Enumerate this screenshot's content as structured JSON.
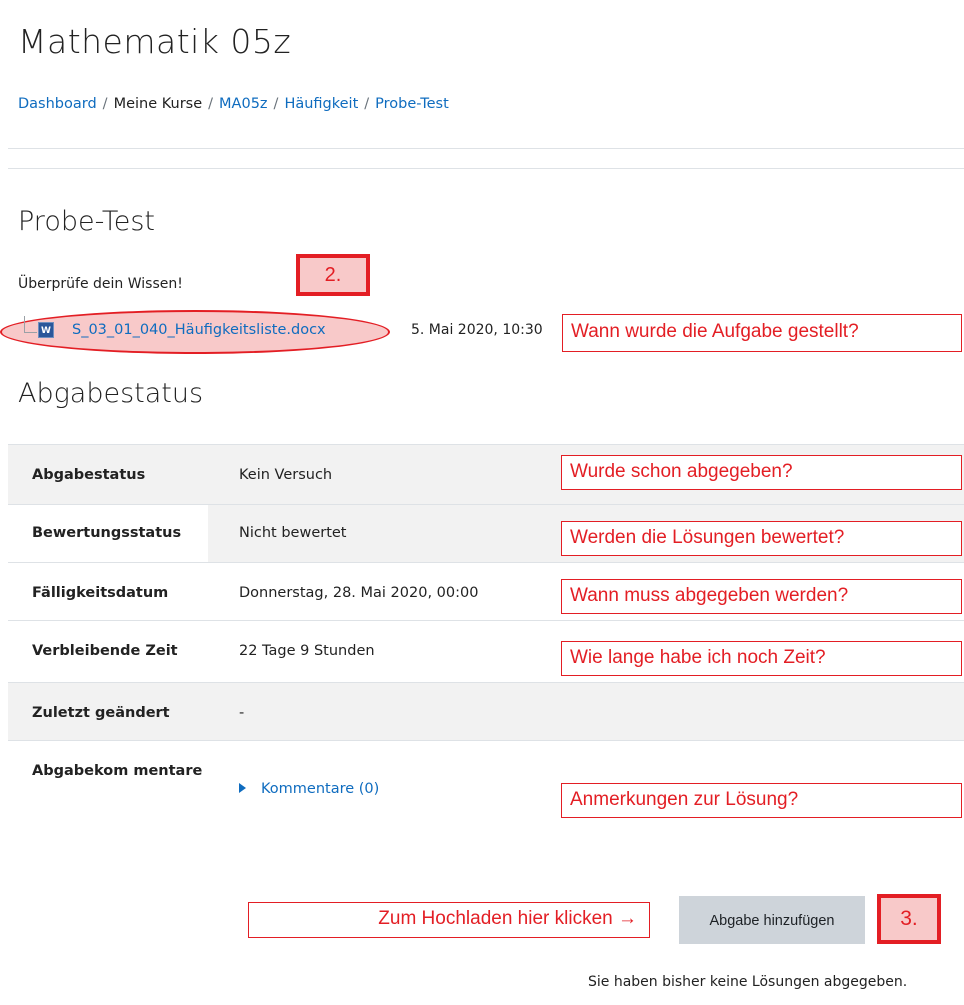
{
  "course": {
    "title": "Mathematik 05z"
  },
  "breadcrumb": {
    "items": [
      {
        "label": "Dashboard",
        "link": true
      },
      {
        "label": "Meine Kurse",
        "link": false
      },
      {
        "label": "MA05z",
        "link": true
      },
      {
        "label": "Häufigkeit",
        "link": true
      },
      {
        "label": "Probe-Test",
        "link": true
      }
    ],
    "separator": "/"
  },
  "assignment": {
    "title": "Probe-Test",
    "intro": "Überprüfe dein Wissen!",
    "file": {
      "name": "S_03_01_040_Häufigkeitsliste.docx",
      "icon": "word-file-icon",
      "date": "5. Mai 2020, 10:30"
    }
  },
  "status_section": {
    "title": "Abgabestatus",
    "rows": [
      {
        "label": "Abgabestatus",
        "value": "Kein Versuch"
      },
      {
        "label": "Bewertungsstatus",
        "value": "Nicht bewertet"
      },
      {
        "label": "Fälligkeitsdatum",
        "value": "Donnerstag, 28. Mai 2020, 00:00"
      },
      {
        "label": "Verbleibende Zeit",
        "value": "22 Tage 9 Stunden"
      },
      {
        "label": "Zuletzt geändert",
        "value": "-"
      },
      {
        "label": "Abgabekom mentare",
        "value": "Kommentare (0)"
      }
    ]
  },
  "actions": {
    "submit_label": "Abgabe hinzufügen",
    "note": "Sie haben bisher keine Lösungen abgegeben."
  },
  "annotations": {
    "step2": "2.",
    "step3": "3.",
    "q_date": "Wann wurde die Aufgabe gestellt?",
    "q_submitted": "Wurde schon abgegeben?",
    "q_graded": "Werden die Lösungen bewertet?",
    "q_due": "Wann muss abgegeben werden?",
    "q_time": "Wie lange habe ich noch Zeit?",
    "q_comments": "Anmerkungen zur Lösung?",
    "upload_hint": "Zum Hochladen hier klicken →",
    "color": "#e31e24"
  },
  "colors": {
    "link": "#0f6cbf",
    "table_shade": "#f2f2f2",
    "button_bg": "#ced4da"
  }
}
